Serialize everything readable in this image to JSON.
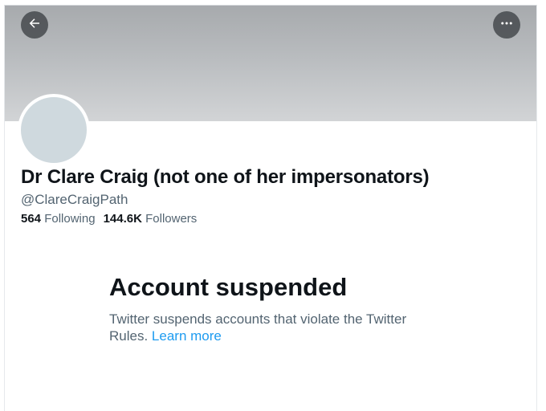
{
  "header": {
    "back_icon": "arrow-left-icon",
    "more_icon": "more-horizontal-icon"
  },
  "profile": {
    "display_name": "Dr Clare Craig (not one of her impersonators)",
    "handle": "@ClareCraigPath",
    "following_count": "564",
    "following_label": "Following",
    "followers_count": "144.6K",
    "followers_label": "Followers"
  },
  "suspension": {
    "title": "Account suspended",
    "message": "Twitter suspends accounts that violate the Twitter Rules.",
    "link_text": "Learn more"
  },
  "colors": {
    "banner": "#b5b8bb",
    "avatar": "#cfd9de",
    "link": "#1d9bf0",
    "text_primary": "#0f1419",
    "text_secondary": "#536471"
  }
}
